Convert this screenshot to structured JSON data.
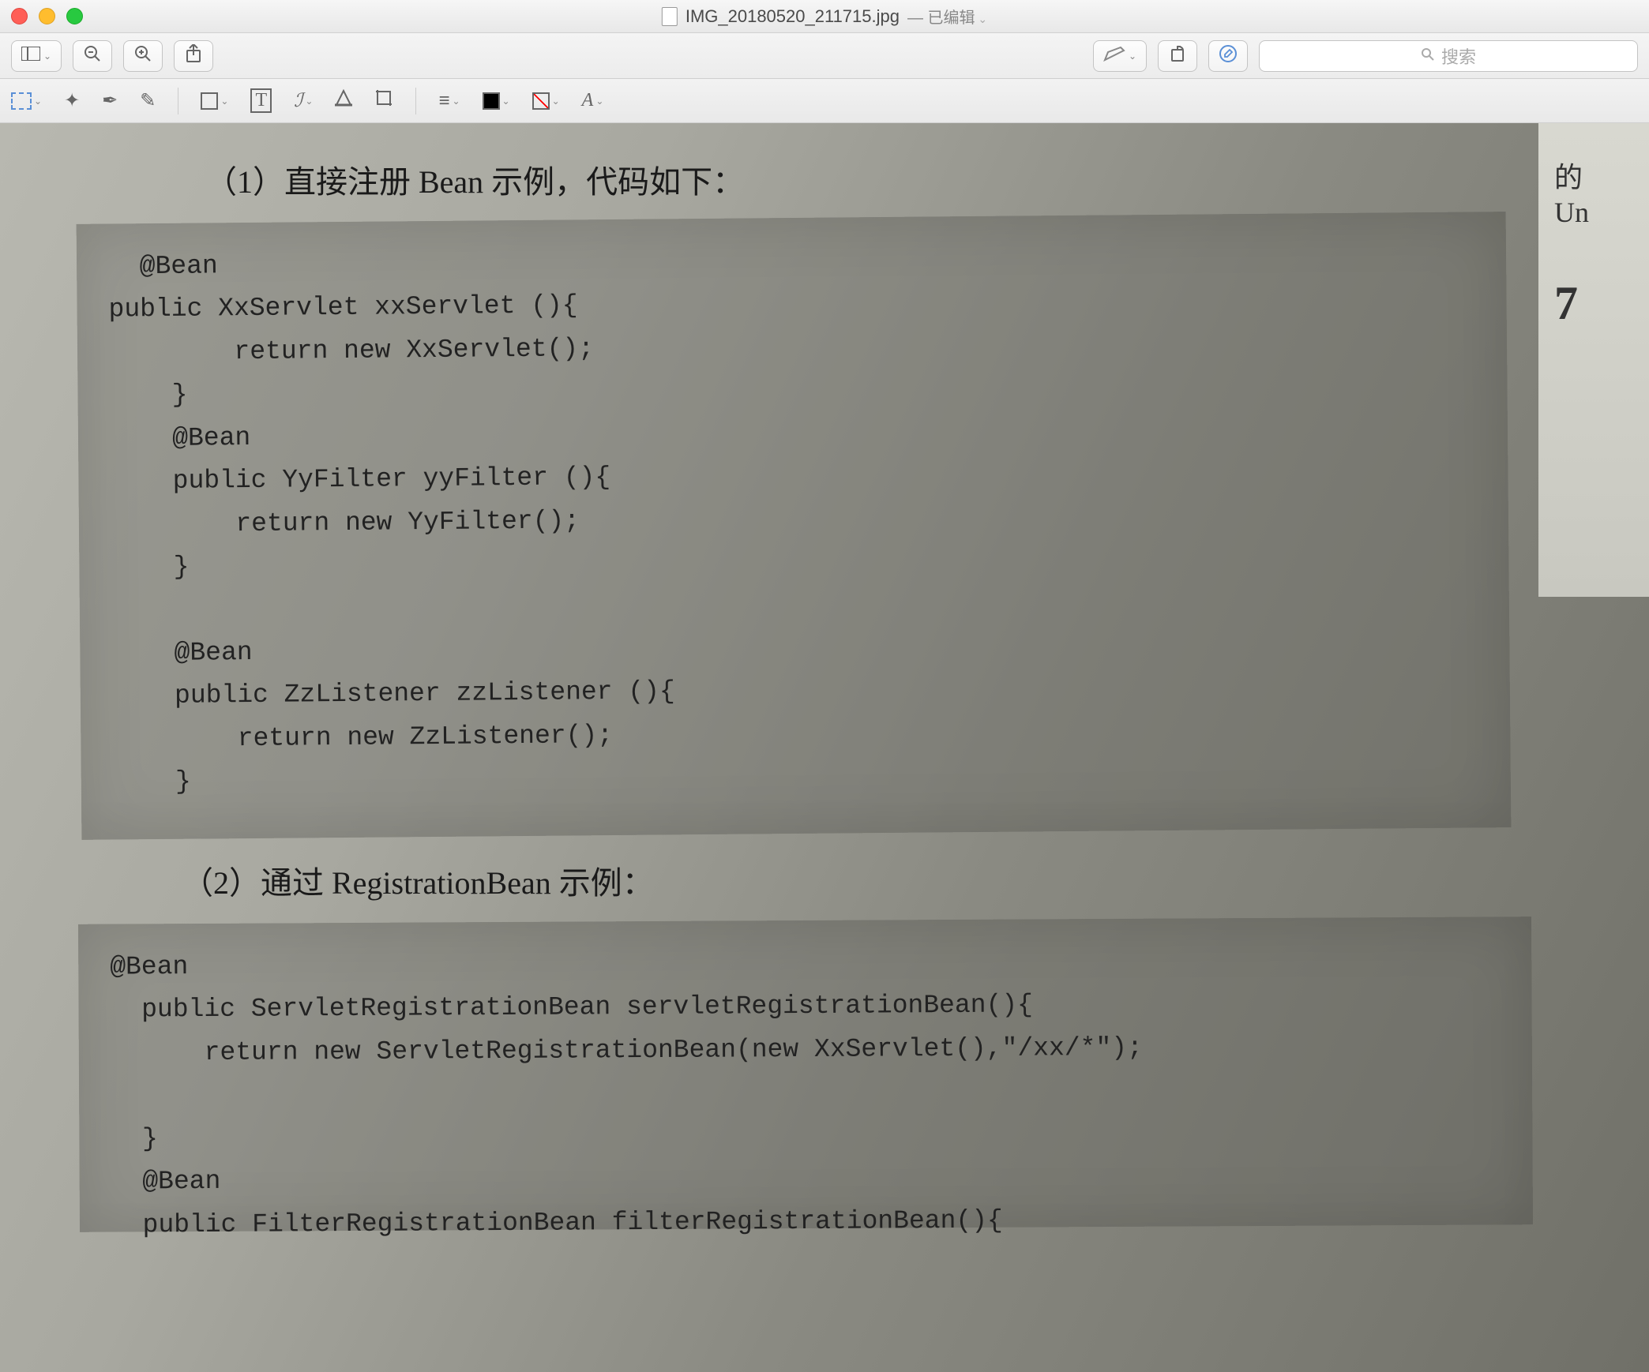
{
  "window": {
    "filename": "IMG_20180520_211715.jpg",
    "status": "— 已编辑"
  },
  "toolbar1": {
    "sidebar_icon": "▢▯",
    "zoom_out": "⊖",
    "zoom_in": "⊕",
    "share": "⇧",
    "markup": "✎",
    "rotate": "⟲",
    "info": "ⓐ",
    "search_placeholder": "搜索"
  },
  "toolbar2": {
    "select": "select",
    "wand": "✦",
    "pen": "✒",
    "pencil": "✎",
    "shape": "▭",
    "text": "T",
    "sign": "ℐ",
    "highlight": "▲",
    "crop": "⌗",
    "lines": "≡",
    "fill": "■",
    "border": "▢",
    "font": "A"
  },
  "page": {
    "heading1": "（1）直接注册 Bean 示例，代码如下：",
    "code1": "  @Bean\npublic XxServlet xxServlet (){\n        return new XxServlet();\n    }\n    @Bean\n    public YyFilter yyFilter (){\n        return new YyFilter();\n    }\n\n    @Bean\n    public ZzListener zzListener (){\n        return new ZzListener();\n    }",
    "heading2": "（2）通过 RegistrationBean 示例：",
    "code2": "@Bean\n  public ServletRegistrationBean servletRegistrationBean(){\n      return new ServletRegistrationBean(new XxServlet(),\"/xx/*\");\n\n  }\n  @Bean\n  public FilterRegistrationBean filterRegistrationBean(){",
    "margin_text1": "的",
    "margin_text2": "Un",
    "margin_num": "7"
  }
}
